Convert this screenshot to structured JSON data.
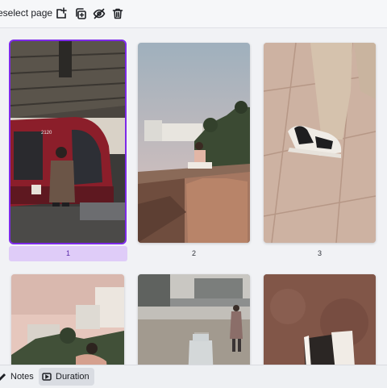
{
  "toolbar": {
    "deselect_label": "eselect page",
    "icons": [
      "add-page-icon",
      "duplicate-page-icon",
      "hide-page-icon",
      "delete-page-icon"
    ]
  },
  "pages": [
    {
      "number": "1",
      "selected": true,
      "scene": "bus-station"
    },
    {
      "number": "2",
      "scene": "beach-rocks"
    },
    {
      "number": "3",
      "scene": "sneakers-floor"
    },
    {
      "number": "",
      "scene": "coastal-buildings"
    },
    {
      "number": "",
      "scene": "street-bottle"
    },
    {
      "number": "",
      "scene": "floor-notebook"
    }
  ],
  "bottom_bar": {
    "notes_label": "Notes",
    "duration_label": "Duration"
  },
  "colors": {
    "accent": "#7d2ae8",
    "selected_label_bg": "#dfccf8"
  }
}
